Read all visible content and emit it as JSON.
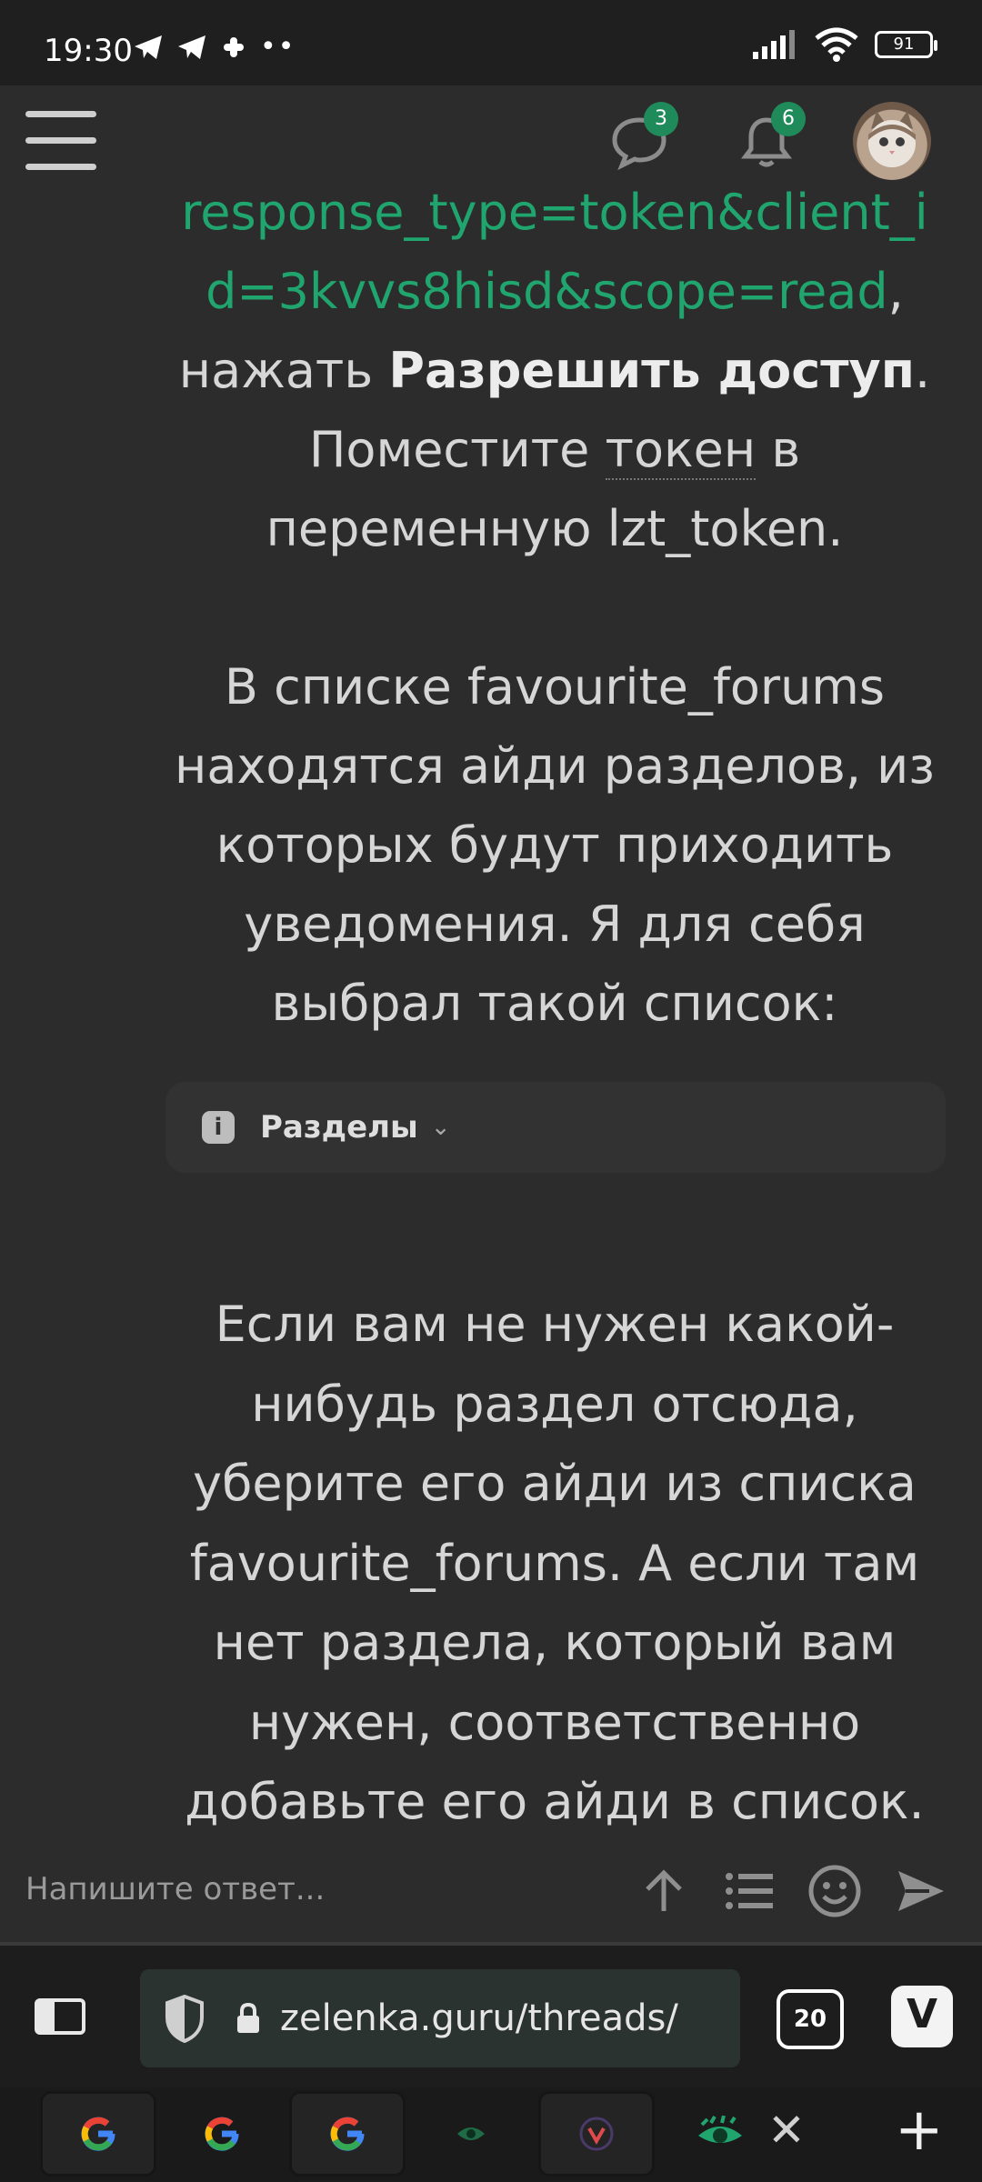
{
  "status": {
    "time": "19:30",
    "battery": "91"
  },
  "header": {
    "messages_badge": "3",
    "alerts_badge": "6"
  },
  "post": {
    "link_line1": "response_type=token&client_i",
    "link_line2": "d=3kvvs8hisd&scope=read",
    "after_link": ",",
    "press": "нажать ",
    "press_bold": "Разрешить доступ",
    "press_end": ".",
    "put_token_pre": "Поместите ",
    "put_token_word": "токен",
    "put_token_post": " в",
    "var_line": "переменную lzt_token.",
    "para2_lines": [
      "В списке favourite_forums",
      "находятся айди разделов, из",
      "которых будут приходить",
      "уведомения. Я для себя",
      "выбрал такой список:"
    ],
    "spoiler_label": "Разделы",
    "para3_lines": [
      "Если вам не нужен какой-",
      "нибудь раздел отсюда,",
      "уберите его айди из списка",
      "favourite_forums. А если там",
      "нет раздела, который вам",
      "нужен, соответственно",
      "добавьте его айди в список."
    ]
  },
  "reply": {
    "placeholder": "Напишите ответ..."
  },
  "browser": {
    "url": "zelenka.guru/threads/",
    "tab_count": "20"
  }
}
